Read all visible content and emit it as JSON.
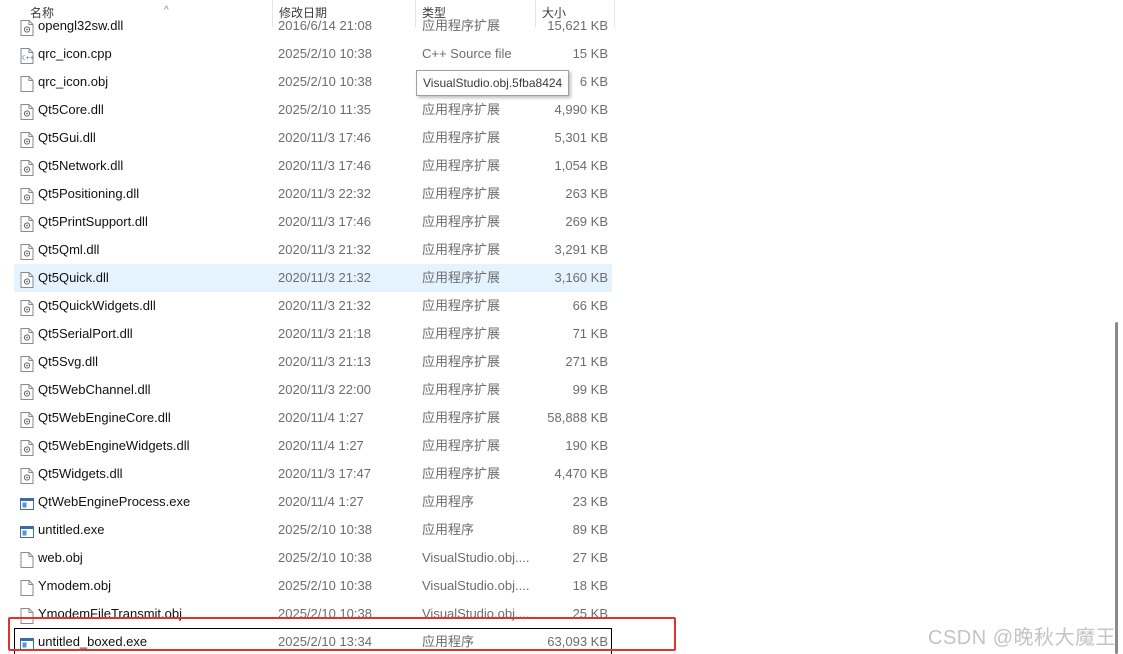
{
  "header": {
    "name": "名称",
    "date": "修改日期",
    "type": "类型",
    "size": "大小",
    "sort_glyph": "^"
  },
  "tooltip": "VisualStudio.obj.5fba8424",
  "rows": [
    {
      "name": "opengl32sw.dll",
      "date": "2016/6/14 21:08",
      "type": "应用程序扩展",
      "size": "15,621 KB",
      "icon": "dll-icon"
    },
    {
      "name": "qrc_icon.cpp",
      "date": "2025/2/10 10:38",
      "type": "C++ Source file",
      "size": "15 KB",
      "icon": "cpp-file-icon"
    },
    {
      "name": "qrc_icon.obj",
      "date": "2025/2/10 10:38",
      "type": "",
      "size": "6 KB",
      "icon": "file-icon"
    },
    {
      "name": "Qt5Core.dll",
      "date": "2025/2/10 11:35",
      "type": "应用程序扩展",
      "size": "4,990 KB",
      "icon": "dll-icon"
    },
    {
      "name": "Qt5Gui.dll",
      "date": "2020/11/3 17:46",
      "type": "应用程序扩展",
      "size": "5,301 KB",
      "icon": "dll-icon"
    },
    {
      "name": "Qt5Network.dll",
      "date": "2020/11/3 17:46",
      "type": "应用程序扩展",
      "size": "1,054 KB",
      "icon": "dll-icon"
    },
    {
      "name": "Qt5Positioning.dll",
      "date": "2020/11/3 22:32",
      "type": "应用程序扩展",
      "size": "263 KB",
      "icon": "dll-icon"
    },
    {
      "name": "Qt5PrintSupport.dll",
      "date": "2020/11/3 17:46",
      "type": "应用程序扩展",
      "size": "269 KB",
      "icon": "dll-icon"
    },
    {
      "name": "Qt5Qml.dll",
      "date": "2020/11/3 21:32",
      "type": "应用程序扩展",
      "size": "3,291 KB",
      "icon": "dll-icon"
    },
    {
      "name": "Qt5Quick.dll",
      "date": "2020/11/3 21:32",
      "type": "应用程序扩展",
      "size": "3,160 KB",
      "icon": "dll-icon",
      "hover": true
    },
    {
      "name": "Qt5QuickWidgets.dll",
      "date": "2020/11/3 21:32",
      "type": "应用程序扩展",
      "size": "66 KB",
      "icon": "dll-icon"
    },
    {
      "name": "Qt5SerialPort.dll",
      "date": "2020/11/3 21:18",
      "type": "应用程序扩展",
      "size": "71 KB",
      "icon": "dll-icon"
    },
    {
      "name": "Qt5Svg.dll",
      "date": "2020/11/3 21:13",
      "type": "应用程序扩展",
      "size": "271 KB",
      "icon": "dll-icon"
    },
    {
      "name": "Qt5WebChannel.dll",
      "date": "2020/11/3 22:00",
      "type": "应用程序扩展",
      "size": "99 KB",
      "icon": "dll-icon"
    },
    {
      "name": "Qt5WebEngineCore.dll",
      "date": "2020/11/4 1:27",
      "type": "应用程序扩展",
      "size": "58,888 KB",
      "icon": "dll-icon"
    },
    {
      "name": "Qt5WebEngineWidgets.dll",
      "date": "2020/11/4 1:27",
      "type": "应用程序扩展",
      "size": "190 KB",
      "icon": "dll-icon"
    },
    {
      "name": "Qt5Widgets.dll",
      "date": "2020/11/3 17:47",
      "type": "应用程序扩展",
      "size": "4,470 KB",
      "icon": "dll-icon"
    },
    {
      "name": "QtWebEngineProcess.exe",
      "date": "2020/11/4 1:27",
      "type": "应用程序",
      "size": "23 KB",
      "icon": "exe-icon"
    },
    {
      "name": "untitled.exe",
      "date": "2025/2/10 10:38",
      "type": "应用程序",
      "size": "89 KB",
      "icon": "exe-icon"
    },
    {
      "name": "web.obj",
      "date": "2025/2/10 10:38",
      "type": "VisualStudio.obj....",
      "size": "27 KB",
      "icon": "file-icon"
    },
    {
      "name": "Ymodem.obj",
      "date": "2025/2/10 10:38",
      "type": "VisualStudio.obj....",
      "size": "18 KB",
      "icon": "file-icon"
    },
    {
      "name": "YmodemFileTransmit.obj",
      "date": "2025/2/10 10:38",
      "type": "VisualStudio.obj....",
      "size": "25 KB",
      "icon": "file-icon"
    },
    {
      "name": "untitled_boxed.exe",
      "date": "2025/2/10 13:34",
      "type": "应用程序",
      "size": "63,093 KB",
      "icon": "exe-icon",
      "boxed": true
    }
  ],
  "watermark": "CSDN @晚秋大魔王",
  "colors": {
    "hover": "#e5f3ff",
    "highlight": "#e0322e"
  }
}
